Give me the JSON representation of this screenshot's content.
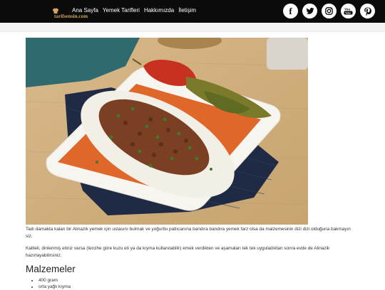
{
  "header": {
    "logo_text": "tarifsensin.com",
    "nav": [
      "Ana Sayfa",
      "Yemek Tarifleri",
      "Hakkımızda",
      "İletişim"
    ],
    "social": [
      {
        "name": "facebook-icon",
        "glyph": "f"
      },
      {
        "name": "twitter-icon",
        "glyph": "t"
      },
      {
        "name": "instagram-icon",
        "glyph": "◎"
      },
      {
        "name": "youtube-icon",
        "glyph": "You"
      },
      {
        "name": "pinterest-icon",
        "glyph": "P"
      }
    ]
  },
  "article": {
    "paragraph1": "Tadı damakta kalan bir Alinazik yemek için ustasını bulmak ve yoğurtlu patlıcanına bandıra bandıra yemek farz olsa da malzemesinin dizi dizi olduğuna bakmayın siz.",
    "paragraph2": "Kaliteli, dinlenmiş etiniz varsa (tercihe göre kuzu eti ya da kıyma kullanılabilir) emek verdikten ve aşamaları tek tek uyguladıktan sonra evde de Alinazik hazırlayabilirsiniz.",
    "section_title": "Malzemeler",
    "ingredients": [
      "400 gram",
      "orta yağlı kıyma"
    ]
  },
  "colors": {
    "header_bg": "#0b0b0b",
    "accent_logo": "#d4a85a"
  }
}
